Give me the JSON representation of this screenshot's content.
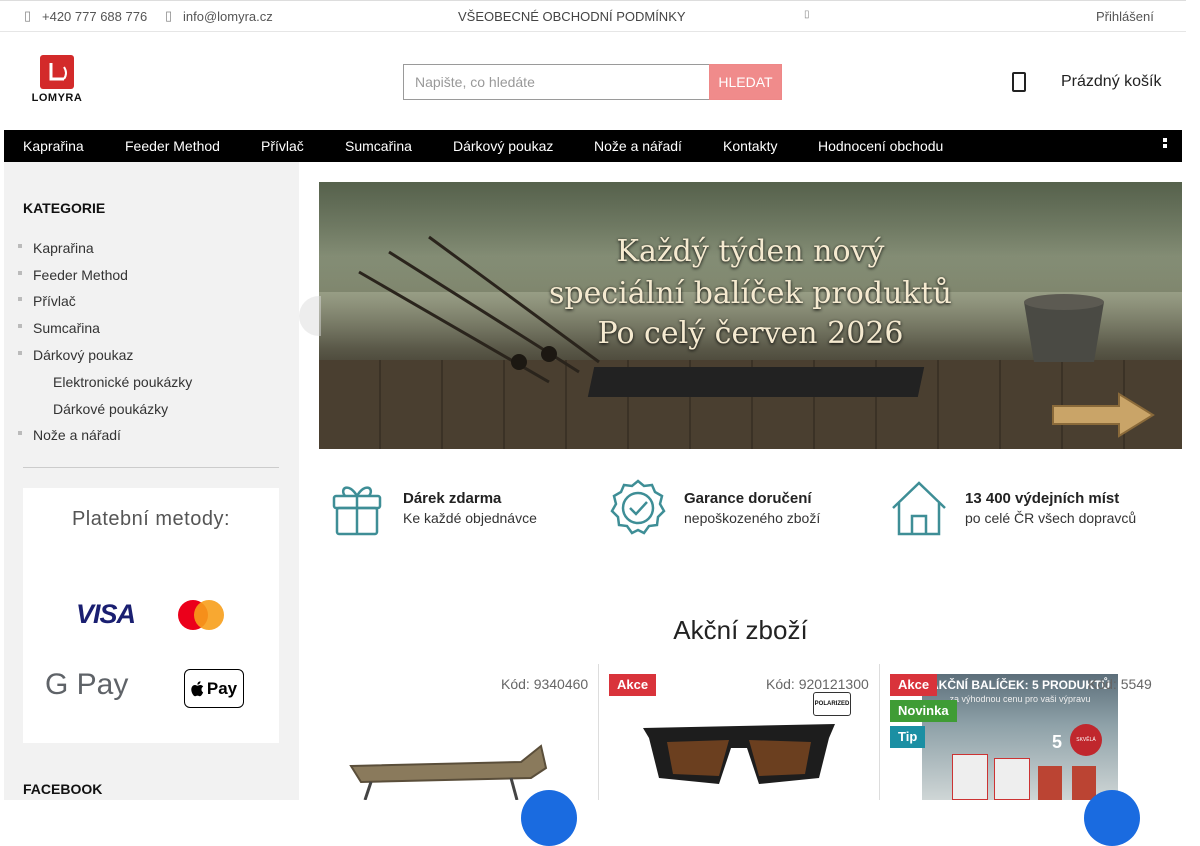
{
  "topbar": {
    "phone": "+420 777 688 776",
    "email": "info@lomyra.cz",
    "terms": "VŠEOBECNÉ OBCHODNÍ PODMÍNKY",
    "login": "Přihlášení"
  },
  "brand": {
    "name": "LOMYRA",
    "color": "#d32a2a"
  },
  "search": {
    "placeholder": "Napište, co hledáte",
    "button": "HLEDAT"
  },
  "cart": {
    "label": "Prázdný košík"
  },
  "nav": {
    "items": [
      "Kaprařina",
      "Feeder Method",
      "Přívlač",
      "Sumcařina",
      "Dárkový poukaz",
      "Nože a nářadí",
      "Kontakty",
      "Hodnocení obchodu"
    ]
  },
  "sidebar": {
    "heading": "KATEGORIE",
    "categories": [
      "Kaprařina",
      "Feeder Method",
      "Přívlač",
      "Sumcařina",
      "Dárkový poukaz",
      "Nože a nářadí"
    ],
    "subcategories": [
      "Elektronické poukázky",
      "Dárkové poukázky"
    ],
    "payment_title": "Platební metody:",
    "payment_methods": [
      "VISA",
      "Mastercard",
      "G Pay",
      "Pay"
    ],
    "facebook": "FACEBOOK"
  },
  "banner": {
    "line1": "Každý týden nový",
    "line2": "speciální balíček produktů",
    "line3": "Po celý červen 2026"
  },
  "benefits": [
    {
      "icon": "gift-icon",
      "title": "Dárek zdarma",
      "text": "Ke každé objednávce"
    },
    {
      "icon": "verified-badge-icon",
      "title": "Garance doručení",
      "text": "nepoškozeného zboží"
    },
    {
      "icon": "home-icon",
      "title": "13 400 výdejních míst",
      "text": "po celé ČR všech dopravců"
    }
  ],
  "sale_section": {
    "title": "Akční zboží"
  },
  "products": [
    {
      "code": "Kód: 9340460",
      "badges": []
    },
    {
      "code": "Kód: 920121300",
      "badges": [
        "Akce"
      ],
      "label": "POLARIZED"
    },
    {
      "code": "Kód: 5549",
      "badges": [
        "Akce",
        "Novinka",
        "Tip"
      ],
      "image_title": "AKČNÍ BALÍČEK: 5 PRODUKTŮ",
      "image_sub": "za výhodnou cenu pro vaši výpravu",
      "image_price": "SKVĚLÁ CENA",
      "image_count": "5"
    }
  ],
  "colors": {
    "accent": "#d32a2a",
    "nav_bg": "#000000",
    "search_button": "#f08b8b",
    "sidebar_bg": "#f2f2f2",
    "benefit_icon": "#3e8e96"
  }
}
